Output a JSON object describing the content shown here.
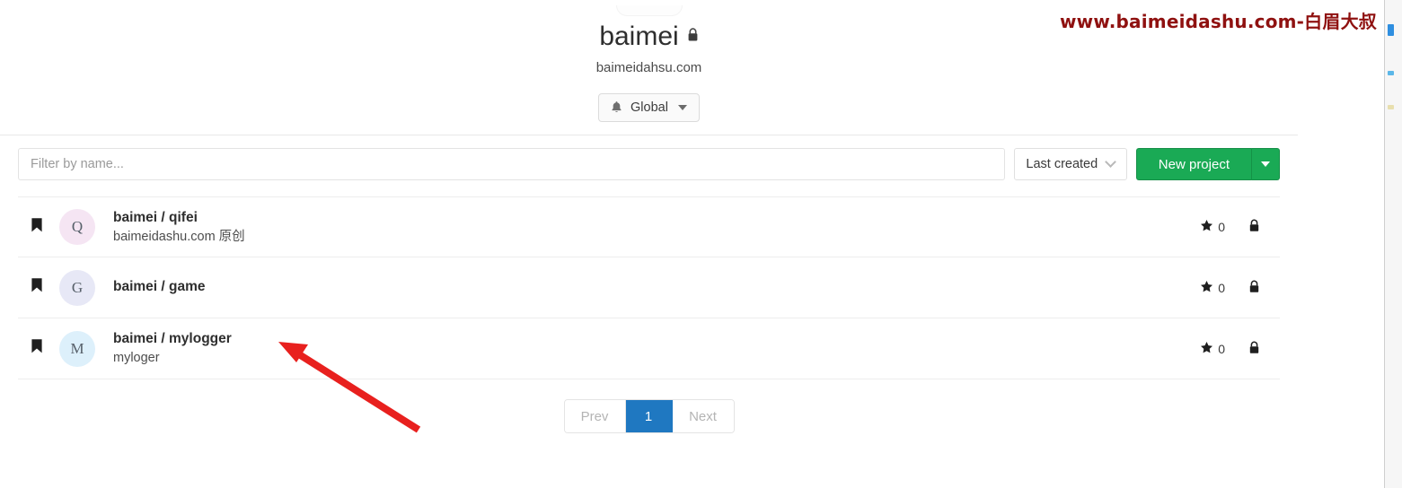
{
  "watermark": {
    "text": "www.baimeidashu.com-白眉大叔",
    "color": "#8f1110"
  },
  "group": {
    "title": "baimei",
    "visibility_icon": "lock-icon",
    "subtitle": "baimeidahsu.com",
    "notification": {
      "label": "Global",
      "icon": "bell-icon",
      "chevron": "chevron-down-icon"
    }
  },
  "toolbar": {
    "filter_placeholder": "Filter by name...",
    "filter_value": "",
    "sort_label": "Last created",
    "new_project_label": "New project"
  },
  "projects": [
    {
      "name": "baimei / qifei",
      "description": "baimeidashu.com 原创",
      "avatar_letter": "Q",
      "avatar_color": "#f5e5f3",
      "stars": "0",
      "visibility_icon": "lock-icon",
      "bookmark_icon": "bookmark-icon"
    },
    {
      "name": "baimei / game",
      "description": "",
      "avatar_letter": "G",
      "avatar_color": "#e7e8f6",
      "stars": "0",
      "visibility_icon": "lock-icon",
      "bookmark_icon": "bookmark-icon"
    },
    {
      "name": "baimei / mylogger",
      "description": "myloger",
      "avatar_letter": "M",
      "avatar_color": "#ddf0fb",
      "stars": "0",
      "visibility_icon": "lock-icon",
      "bookmark_icon": "bookmark-icon"
    }
  ],
  "pagination": {
    "prev_label": "Prev",
    "current_page": "1",
    "next_label": "Next"
  },
  "annotation": {
    "arrow_color": "#e8201e"
  },
  "icons": {
    "star": "★",
    "lock": "🔒"
  }
}
